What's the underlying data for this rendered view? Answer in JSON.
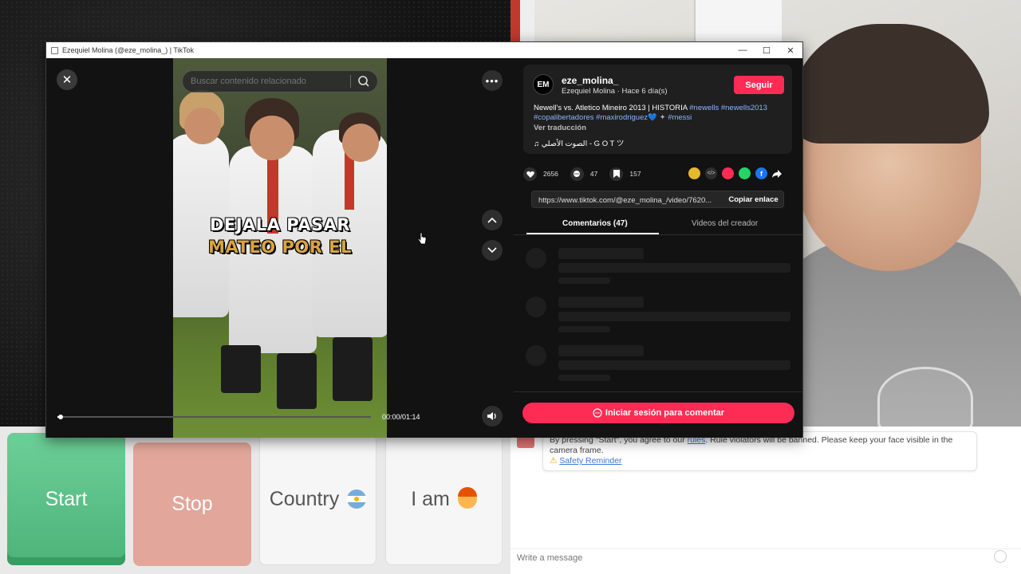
{
  "window": {
    "title": "Ezequiel Molina (@eze_molina_) | TikTok",
    "minimize": "—",
    "maximize": "☐",
    "close": "✕"
  },
  "player": {
    "close_glyph": "✕",
    "search_placeholder": "Buscar contenido relacionado",
    "more_glyph": "•••",
    "video_caption_line1": "DEJALA PASAR",
    "video_caption_line2": "MATEO POR EL",
    "time": "00:00/01:14",
    "progress": 0.01
  },
  "post": {
    "avatar_initials": "EM",
    "username": "eze_molina_",
    "meta": "Ezequiel Molina · Hace 6 día(s)",
    "follow_label": "Seguir",
    "description_text": "Newell's vs. Atletico Mineiro 2013 | HISTORIA",
    "tag1": "#newells",
    "tag2": "#newells2013",
    "tag3": "#copalibertadores",
    "tag4": "#maxirodriguez💙",
    "tag5": "#messi",
    "translate": "Ver traducción",
    "sound": "♫  الصوت الأصلي - G O T ツ",
    "likes": "2656",
    "comments": "47",
    "saves": "157",
    "link": "https://www.tiktok.com/@eze_molina_/video/7620...",
    "copy_label": "Copiar enlace",
    "tab_comments": "Comentarios (47)",
    "tab_creator": "Videos del creador",
    "login_label": "Iniciar sesión para comentar"
  },
  "app": {
    "start": "Start",
    "stop": "Stop",
    "country": "Country",
    "iam": "I am"
  },
  "chat": {
    "notice_before": "By pressing \"Start\", you agree to our ",
    "notice_link": "rules",
    "notice_after": ". Rule violators will be banned. Please keep your face visible in the camera frame.",
    "safety": "Safety Reminder",
    "input_placeholder": "Write a message"
  },
  "colors": {
    "tiktok_red": "#fe2c55",
    "start_green": "#4db379",
    "stop_pink": "#e2a69a",
    "hashtag_blue": "#8ab4ff"
  }
}
